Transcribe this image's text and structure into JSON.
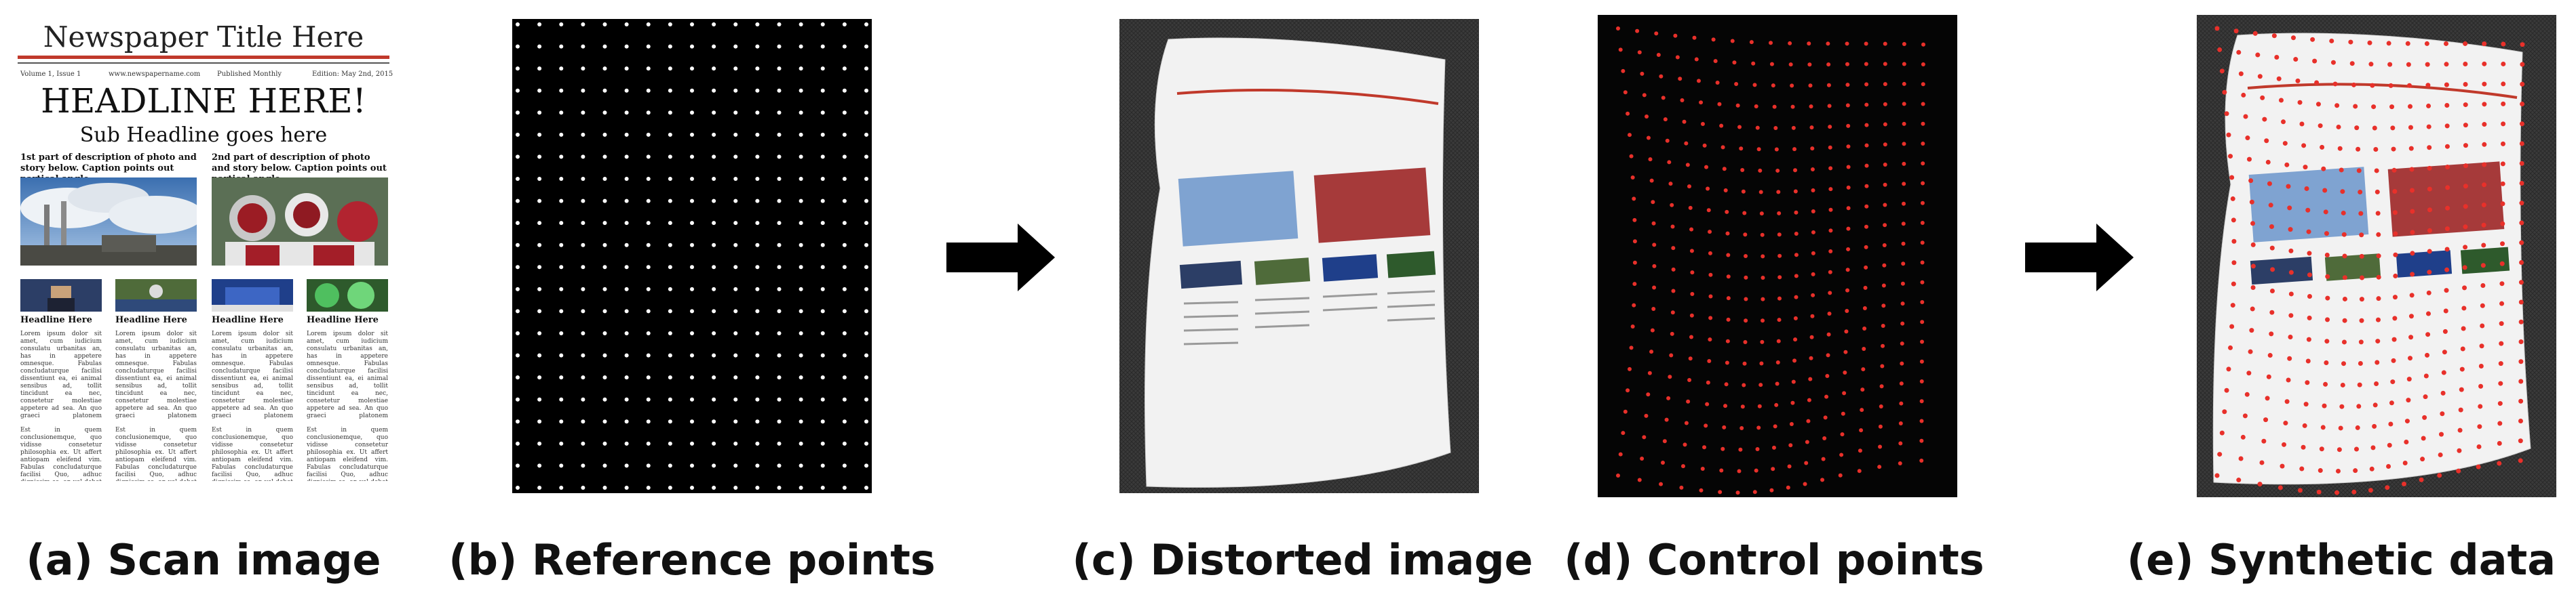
{
  "captions": {
    "a": "(a) Scan image",
    "b": "(b) Reference points",
    "c": "(c) Distorted image",
    "d": "(d) Control points",
    "e": "(e) Synthetic data"
  },
  "newspaper": {
    "title": "Newspaper Title Here",
    "meta_volume": "Volume 1, Issue 1",
    "meta_site": "www.newspapername.com",
    "meta_published": "Published Monthly",
    "meta_edition": "Edition: May 2nd, 2015",
    "headline": "HEADLINE HERE!",
    "subheadline": "Sub Headline goes here",
    "caption_left": "1st part of description of photo and story below. Caption points out partical angle.",
    "caption_right": "2nd part of description of photo and story below. Caption points out partical angle.",
    "column_heading": "Headline Here",
    "body_text": "Lorem ipsum dolor sit amet, cum iudicium consulatu urbanitas an, has in appetere omnesque. Fabulas concludaturque facilisi dissentiunt ea, ei animal sensibus ad, tollit tincidunt ea nec, consetetur molestiae appetere ad sea. An quo graeci platonem persecuti, nec nusquam in alterum.",
    "body_text_2": "Est in quem conclusionemque, quo vidisse consetetur philosophia ex. Ut affert antiopam eleifend vim. Fabulas concludaturque facilisi Quo, adhuc dignissim ea, an vel debet vim."
  }
}
